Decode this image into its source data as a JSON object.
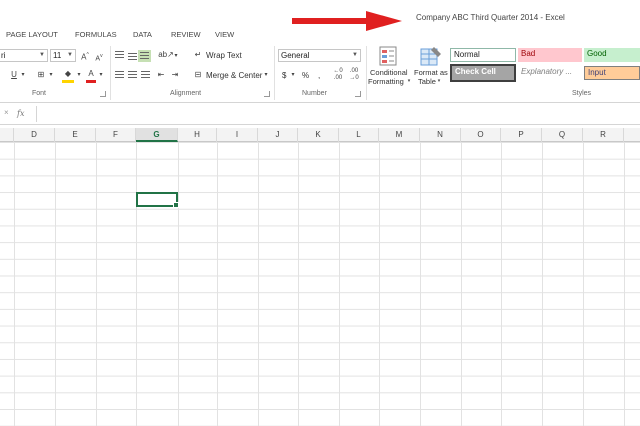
{
  "window": {
    "title": "Company ABC Third Quarter 2014 - Excel"
  },
  "tabs": [
    "PAGE LAYOUT",
    "FORMULAS",
    "DATA",
    "REVIEW",
    "VIEW"
  ],
  "ribbon": {
    "font": {
      "name_partial": "ri",
      "size": "11",
      "group_label": "Font"
    },
    "alignment": {
      "wrap_text": "Wrap Text",
      "merge_center": "Merge & Center",
      "group_label": "Alignment"
    },
    "number": {
      "format": "General",
      "currency": "$",
      "percent": "%",
      "comma": ",",
      "group_label": "Number"
    },
    "styles": {
      "conditional_formatting_1": "Conditional",
      "conditional_formatting_2": "Formatting",
      "format_as_table_1": "Format as",
      "format_as_table_2": "Table",
      "group_label": "Styles",
      "cells": {
        "normal": "Normal",
        "bad": "Bad",
        "good": "Good",
        "check_cell": "Check Cell",
        "explanatory": "Explanatory ...",
        "input": "Input"
      }
    }
  },
  "formula_bar": {
    "fx": "fx",
    "cancel": "×",
    "value": ""
  },
  "columns": [
    "D",
    "E",
    "F",
    "G",
    "H",
    "I",
    "J",
    "K",
    "L",
    "M",
    "N",
    "O",
    "P",
    "Q",
    "R"
  ],
  "selected_column": "G",
  "colors": {
    "accent": "#217346",
    "arrow": "#e02020"
  }
}
